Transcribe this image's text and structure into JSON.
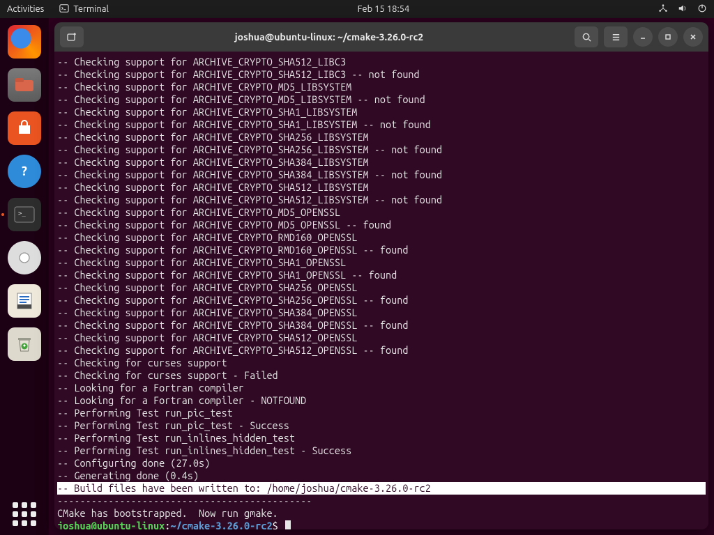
{
  "top_panel": {
    "activities": "Activities",
    "app_name": "Terminal",
    "clock": "Feb 15  18:54"
  },
  "window": {
    "title": "joshua@ubuntu-linux: ~/cmake-3.26.0-rc2"
  },
  "terminal": {
    "lines": [
      "-- Checking support for ARCHIVE_CRYPTO_SHA512_LIBC3",
      "-- Checking support for ARCHIVE_CRYPTO_SHA512_LIBC3 -- not found",
      "-- Checking support for ARCHIVE_CRYPTO_MD5_LIBSYSTEM",
      "-- Checking support for ARCHIVE_CRYPTO_MD5_LIBSYSTEM -- not found",
      "-- Checking support for ARCHIVE_CRYPTO_SHA1_LIBSYSTEM",
      "-- Checking support for ARCHIVE_CRYPTO_SHA1_LIBSYSTEM -- not found",
      "-- Checking support for ARCHIVE_CRYPTO_SHA256_LIBSYSTEM",
      "-- Checking support for ARCHIVE_CRYPTO_SHA256_LIBSYSTEM -- not found",
      "-- Checking support for ARCHIVE_CRYPTO_SHA384_LIBSYSTEM",
      "-- Checking support for ARCHIVE_CRYPTO_SHA384_LIBSYSTEM -- not found",
      "-- Checking support for ARCHIVE_CRYPTO_SHA512_LIBSYSTEM",
      "-- Checking support for ARCHIVE_CRYPTO_SHA512_LIBSYSTEM -- not found",
      "-- Checking support for ARCHIVE_CRYPTO_MD5_OPENSSL",
      "-- Checking support for ARCHIVE_CRYPTO_MD5_OPENSSL -- found",
      "-- Checking support for ARCHIVE_CRYPTO_RMD160_OPENSSL",
      "-- Checking support for ARCHIVE_CRYPTO_RMD160_OPENSSL -- found",
      "-- Checking support for ARCHIVE_CRYPTO_SHA1_OPENSSL",
      "-- Checking support for ARCHIVE_CRYPTO_SHA1_OPENSSL -- found",
      "-- Checking support for ARCHIVE_CRYPTO_SHA256_OPENSSL",
      "-- Checking support for ARCHIVE_CRYPTO_SHA256_OPENSSL -- found",
      "-- Checking support for ARCHIVE_CRYPTO_SHA384_OPENSSL",
      "-- Checking support for ARCHIVE_CRYPTO_SHA384_OPENSSL -- found",
      "-- Checking support for ARCHIVE_CRYPTO_SHA512_OPENSSL",
      "-- Checking support for ARCHIVE_CRYPTO_SHA512_OPENSSL -- found",
      "-- Checking for curses support",
      "-- Checking for curses support - Failed",
      "-- Looking for a Fortran compiler",
      "-- Looking for a Fortran compiler - NOTFOUND",
      "-- Performing Test run_pic_test",
      "-- Performing Test run_pic_test - Success",
      "-- Performing Test run_inlines_hidden_test",
      "-- Performing Test run_inlines_hidden_test - Success",
      "-- Configuring done (27.0s)",
      "-- Generating done (0.4s)"
    ],
    "highlight_line": "-- Build files have been written to: /home/joshua/cmake-3.26.0-rc2",
    "dashes": "---------------------------------------------",
    "bootstrap_line": "CMake has bootstrapped.  Now run gmake.",
    "prompt_user": "joshua@ubuntu-linux",
    "prompt_sep1": ":",
    "prompt_path": "~/cmake-3.26.0-rc2",
    "prompt_sep2": "$"
  }
}
